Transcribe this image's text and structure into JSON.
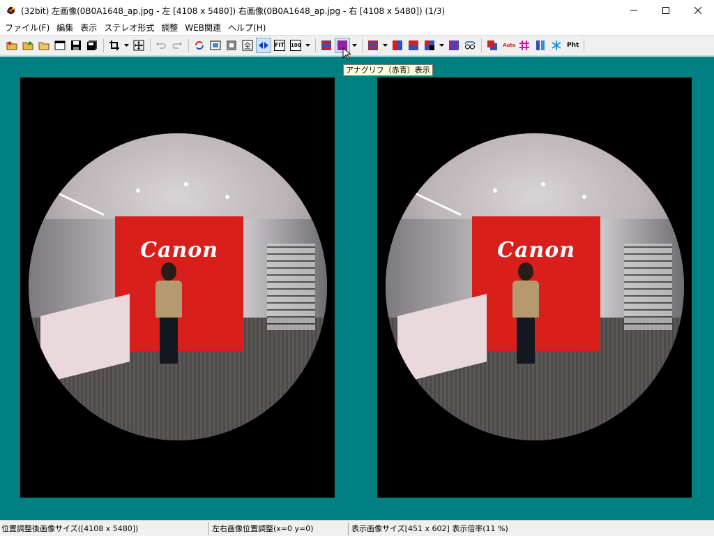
{
  "window": {
    "title": "(32bit) 左画像(0B0A1648_ap.jpg - 左 [4108 x 5480]) 右画像(0B0A1648_ap.jpg - 右 [4108 x 5480]) (1/3)",
    "icon": "app-logo-icon",
    "controls": [
      "minimize-icon",
      "maximize-icon",
      "close-icon"
    ]
  },
  "menu": {
    "items": [
      "ファイル(F)",
      "編集",
      "表示",
      "ステレオ形式",
      "調整",
      "WEB関連",
      "ヘルプ(H)"
    ]
  },
  "toolbar": {
    "fit_label": "FIT",
    "zoom100_label": "100",
    "auto_label": "Auto",
    "pht_label": "Pht",
    "tooltip": "アナグリフ（赤青）表示"
  },
  "viewer": {
    "background_color": "#008080",
    "brand_text": "Canon"
  },
  "status": {
    "adjusted_size": "位置調整後画像サイズ([4108 x 5480])",
    "position_adjust": "左右画像位置調整(x=0 y=0)",
    "display_size": "表示画像サイズ[451 x 602]  表示倍率(11 %)"
  }
}
